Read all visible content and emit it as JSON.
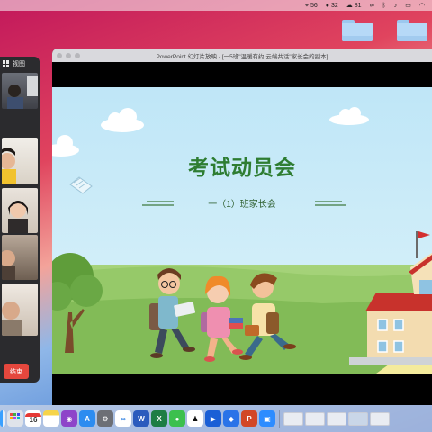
{
  "menubar": {
    "items": [
      {
        "icon": "bluetooth-icon",
        "text": "56"
      },
      {
        "icon": "drop-icon",
        "text": "32"
      },
      {
        "icon": "cloud-icon",
        "text": "81"
      },
      {
        "icon": "link-icon",
        "text": ""
      },
      {
        "icon": "bluetooth-symbol-icon",
        "text": ""
      },
      {
        "icon": "volume-icon",
        "text": ""
      },
      {
        "icon": "battery-icon",
        "text": ""
      },
      {
        "icon": "wifi-icon",
        "text": ""
      }
    ]
  },
  "meeting": {
    "view_label": "视图",
    "end_label": "结束"
  },
  "window": {
    "title": "PowerPoint 幻灯片放映 - [一5班\"温暖有约 云端共话\"家长会的副本]"
  },
  "slide": {
    "title": "考试动员会",
    "subtitle": "一（1）班家长会"
  },
  "colors": {
    "slide_title": "#2e7d32",
    "end_button": "#e5473d",
    "sky": "#bfe6f7",
    "grass": "#8cc463"
  },
  "dock": {
    "calendar_day": "16",
    "apps": [
      "finder-icon",
      "launchpad-icon",
      "calendar-icon",
      "notes-icon",
      "podcasts-icon",
      "app-store-icon",
      "system-preferences-icon",
      "baidu-netdisk-icon",
      "word-icon",
      "excel-icon",
      "wechat-icon",
      "qq-icon",
      "feishu-icon",
      "lark-icon",
      "powerpoint-icon",
      "zoom-icon"
    ]
  }
}
